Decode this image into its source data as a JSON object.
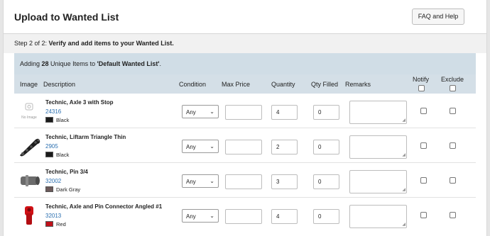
{
  "header": {
    "title": "Upload to Wanted List",
    "faq_label": "FAQ and Help"
  },
  "step": {
    "prefix": "Step 2 of 2: ",
    "text": "Verify and add items to your Wanted List."
  },
  "summary": {
    "pre": "Adding ",
    "count": "28",
    "mid": " Unique Items to ",
    "list_name": "'Default Wanted List'",
    "post": "."
  },
  "columns": {
    "image": "Image",
    "description": "Description",
    "condition": "Condition",
    "max_price": "Max Price",
    "quantity": "Quantity",
    "qty_filled": "Qty Filled",
    "remarks": "Remarks",
    "notify": "Notify",
    "exclude": "Exclude"
  },
  "rows": [
    {
      "image_text": "No Image",
      "name": "Technic, Axle 3 with Stop",
      "part_id": "24316",
      "color_name": "Black",
      "color_hex": "#1b1b1b",
      "condition": "Any",
      "max_price": "",
      "quantity": "4",
      "qty_filled": "0",
      "remarks": "",
      "notify": false,
      "exclude": false
    },
    {
      "image_text": "",
      "name": "Technic, Liftarm Triangle Thin",
      "part_id": "2905",
      "color_name": "Black",
      "color_hex": "#1b1b1b",
      "condition": "Any",
      "max_price": "",
      "quantity": "2",
      "qty_filled": "0",
      "remarks": "",
      "notify": false,
      "exclude": false
    },
    {
      "image_text": "",
      "name": "Technic, Pin 3/4",
      "part_id": "32002",
      "color_name": "Dark Gray",
      "color_hex": "#6b5a5a",
      "condition": "Any",
      "max_price": "",
      "quantity": "3",
      "qty_filled": "0",
      "remarks": "",
      "notify": false,
      "exclude": false
    },
    {
      "image_text": "",
      "name": "Technic, Axle and Pin Connector Angled #1",
      "part_id": "32013",
      "color_name": "Red",
      "color_hex": "#c0111a",
      "condition": "Any",
      "max_price": "",
      "quantity": "4",
      "qty_filled": "0",
      "remarks": "",
      "notify": false,
      "exclude": false
    }
  ]
}
